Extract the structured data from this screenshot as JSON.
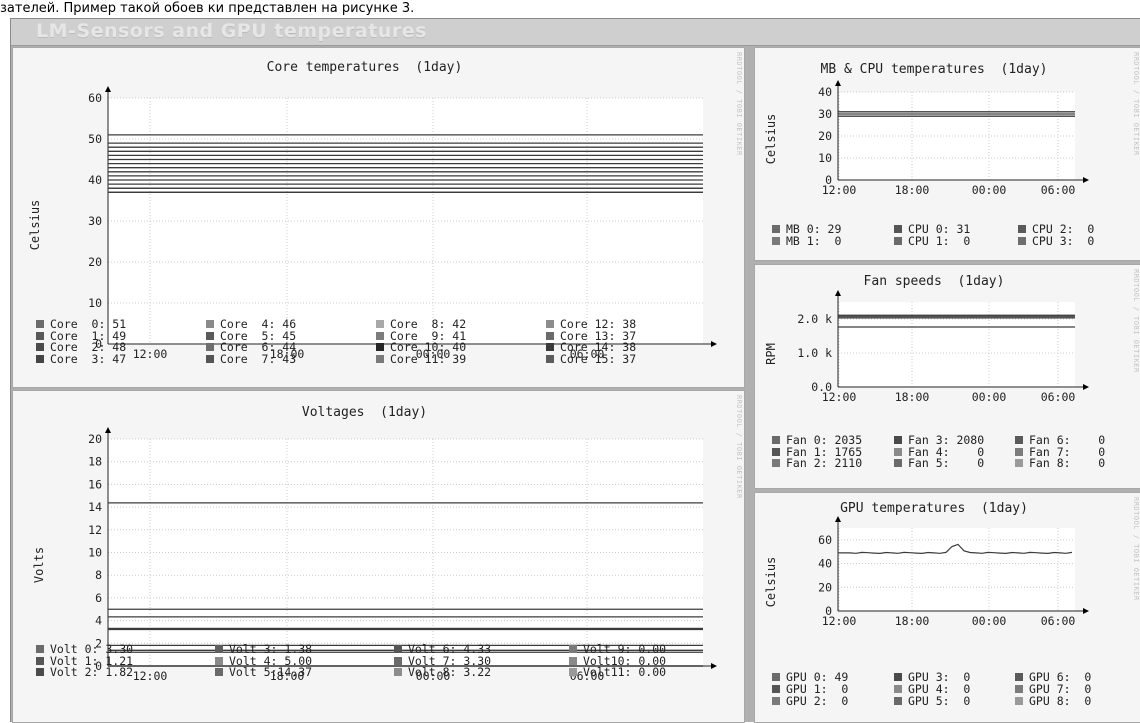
{
  "caption": "зателей. Пример такой обоев ки представлен на рисунке 3.",
  "window": {
    "title": "LM-Sensors and GPU temperatures"
  },
  "watermark": "RRDTOOL / TOBI OETIKER",
  "colors": {
    "frame": "#b0b0b0",
    "panel": "#f5f5f5",
    "plot": "#ffffff",
    "grid": "#d0d0d0",
    "line": "#404040"
  },
  "graphs": [
    {
      "id": "core",
      "title": "Core temperatures  (1day)",
      "ylabel": "Celsius",
      "y_ticks": [
        "0",
        "10",
        "20",
        "30",
        "40",
        "50",
        "60"
      ],
      "y_max": 60,
      "x_ticks": [
        "12:00",
        "18:00",
        "00:00",
        "06:00"
      ],
      "lines": [
        51,
        49,
        48,
        47,
        46,
        45,
        44,
        43,
        42,
        41,
        40,
        39,
        38,
        37,
        38,
        37
      ],
      "legend_cols": [
        [
          "Core  0: 51",
          "Core  1: 49",
          "Core  2: 48",
          "Core  3: 47"
        ],
        [
          "Core  4: 46",
          "Core  5: 45",
          "Core  6: 44",
          "Core  7: 43"
        ],
        [
          "Core  8: 42",
          "Core  9: 41",
          "Core 10: 40",
          "Core 11: 39"
        ],
        [
          "Core 12: 38",
          "Core 13: 37",
          "Core 14: 38",
          "Core 15: 37"
        ]
      ],
      "swatches": [
        [
          "#6b6b6b",
          "#595959",
          "#4c4c4c",
          "#454545"
        ],
        [
          "#8a8a8a",
          "#5a5a5a",
          "#6e6e6e",
          "#555555"
        ],
        [
          "#a8a8a8",
          "#7c7c7c",
          "#262626",
          "#7a7a7a"
        ],
        [
          "#8c8c8c",
          "#6a6a6a",
          "#3a3a3a",
          "#5c5c5c"
        ]
      ]
    },
    {
      "id": "volt",
      "title": "Voltages  (1day)",
      "ylabel": "Volts",
      "y_ticks": [
        "0",
        "2",
        "4",
        "6",
        "8",
        "10",
        "12",
        "14",
        "16",
        "18",
        "20"
      ],
      "y_max": 20,
      "x_ticks": [
        "12:00",
        "18:00",
        "00:00",
        "06:00"
      ],
      "lines": [
        3.3,
        1.21,
        1.82,
        1.38,
        5.0,
        14.37,
        4.33,
        3.3,
        3.22,
        0.0,
        0.0,
        0.0
      ],
      "legend_cols": [
        [
          "Volt 0: 3.30",
          "Volt 1: 1.21",
          "Volt 2: 1.82"
        ],
        [
          "Volt 3: 1.38",
          "Volt 4: 5.00",
          "Volt 5:14.37"
        ],
        [
          "Volt 6: 4.33",
          "Volt 7: 3.30",
          "Volt 8: 3.22"
        ],
        [
          "Volt 9: 0.00",
          "Volt10: 0.00",
          "Volt11: 0.00"
        ]
      ],
      "swatches": [
        [
          "#6b6b6b",
          "#555555",
          "#4a4a4a"
        ],
        [
          "#5e5e5e",
          "#8a8a8a",
          "#6a6a6a"
        ],
        [
          "#555555",
          "#6b6b6b",
          "#8c8c8c"
        ],
        [
          "#7a7a7a",
          "#8a8a8a",
          "#9a9a9a"
        ]
      ]
    },
    {
      "id": "mbcpu",
      "title": "MB & CPU temperatures  (1day)",
      "ylabel": "Celsius",
      "y_ticks": [
        "0",
        "10",
        "20",
        "30",
        "40"
      ],
      "y_max": 40,
      "x_ticks": [
        "12:00",
        "18:00",
        "00:00",
        "06:00"
      ],
      "lines": [
        29,
        31,
        30
      ],
      "legend_cols": [
        [
          "MB 0: 29",
          "MB 1:  0"
        ],
        [
          "CPU 0: 31",
          "CPU 1:  0"
        ],
        [
          "CPU 2:  0",
          "CPU 3:  0"
        ]
      ],
      "swatches": [
        [
          "#6b6b6b",
          "#7a7a7a"
        ],
        [
          "#555555",
          "#6a6a6a"
        ],
        [
          "#5a5a5a",
          "#6e6e6e"
        ]
      ]
    },
    {
      "id": "fan",
      "title": "Fan speeds  (1day)",
      "ylabel": "RPM",
      "y_ticks": [
        "0.0",
        "1.0 k",
        "2.0 k"
      ],
      "y_max": 2500,
      "x_ticks": [
        "12:00",
        "18:00",
        "00:00",
        "06:00"
      ],
      "lines": [
        2035,
        1765,
        2110,
        2080
      ],
      "legend_cols": [
        [
          "Fan 0: 2035",
          "Fan 1: 1765",
          "Fan 2: 2110"
        ],
        [
          "Fan 3: 2080",
          "Fan 4:    0",
          "Fan 5:    0"
        ],
        [
          "Fan 6:    0",
          "Fan 7:    0",
          "Fan 8:    0"
        ]
      ],
      "swatches": [
        [
          "#6b6b6b",
          "#555555",
          "#7a7a7a"
        ],
        [
          "#4a4a4a",
          "#8a8a8a",
          "#6a6a6a"
        ],
        [
          "#5a5a5a",
          "#7c7c7c",
          "#9a9a9a"
        ]
      ]
    },
    {
      "id": "gpu",
      "title": "GPU temperatures  (1day)",
      "ylabel": "Celsius",
      "y_ticks": [
        "0",
        "20",
        "40",
        "60"
      ],
      "y_max": 70,
      "x_ticks": [
        "12:00",
        "18:00",
        "00:00",
        "06:00"
      ],
      "lines": [],
      "legend_cols": [
        [
          "GPU 0: 49",
          "GPU 1:  0",
          "GPU 2:  0"
        ],
        [
          "GPU 3:  0",
          "GPU 4:  0",
          "GPU 5:  0"
        ],
        [
          "GPU 6:  0",
          "GPU 7:  0",
          "GPU 8:  0"
        ]
      ],
      "swatches": [
        [
          "#6b6b6b",
          "#555555",
          "#7a7a7a"
        ],
        [
          "#4a4a4a",
          "#8a8a8a",
          "#6a6a6a"
        ],
        [
          "#5a5a5a",
          "#7c7c7c",
          "#9a9a9a"
        ]
      ]
    }
  ],
  "chart_data": [
    {
      "type": "line",
      "title": "Core temperatures  (1day)",
      "ylabel": "Celsius",
      "ylim": [
        0,
        60
      ],
      "x": [
        "12:00",
        "18:00",
        "00:00",
        "06:00"
      ],
      "series": [
        {
          "name": "Core  0",
          "value": 51
        },
        {
          "name": "Core  1",
          "value": 49
        },
        {
          "name": "Core  2",
          "value": 48
        },
        {
          "name": "Core  3",
          "value": 47
        },
        {
          "name": "Core  4",
          "value": 46
        },
        {
          "name": "Core  5",
          "value": 45
        },
        {
          "name": "Core  6",
          "value": 44
        },
        {
          "name": "Core  7",
          "value": 43
        },
        {
          "name": "Core  8",
          "value": 42
        },
        {
          "name": "Core  9",
          "value": 41
        },
        {
          "name": "Core 10",
          "value": 40
        },
        {
          "name": "Core 11",
          "value": 39
        },
        {
          "name": "Core 12",
          "value": 38
        },
        {
          "name": "Core 13",
          "value": 37
        },
        {
          "name": "Core 14",
          "value": 38
        },
        {
          "name": "Core 15",
          "value": 37
        }
      ]
    },
    {
      "type": "line",
      "title": "Voltages  (1day)",
      "ylabel": "Volts",
      "ylim": [
        0,
        20
      ],
      "x": [
        "12:00",
        "18:00",
        "00:00",
        "06:00"
      ],
      "series": [
        {
          "name": "Volt 0",
          "value": 3.3
        },
        {
          "name": "Volt 1",
          "value": 1.21
        },
        {
          "name": "Volt 2",
          "value": 1.82
        },
        {
          "name": "Volt 3",
          "value": 1.38
        },
        {
          "name": "Volt 4",
          "value": 5.0
        },
        {
          "name": "Volt 5",
          "value": 14.37
        },
        {
          "name": "Volt 6",
          "value": 4.33
        },
        {
          "name": "Volt 7",
          "value": 3.3
        },
        {
          "name": "Volt 8",
          "value": 3.22
        },
        {
          "name": "Volt 9",
          "value": 0.0
        },
        {
          "name": "Volt10",
          "value": 0.0
        },
        {
          "name": "Volt11",
          "value": 0.0
        }
      ]
    },
    {
      "type": "line",
      "title": "MB & CPU temperatures  (1day)",
      "ylabel": "Celsius",
      "ylim": [
        0,
        40
      ],
      "x": [
        "12:00",
        "18:00",
        "00:00",
        "06:00"
      ],
      "series": [
        {
          "name": "MB 0",
          "value": 29
        },
        {
          "name": "MB 1",
          "value": 0
        },
        {
          "name": "CPU 0",
          "value": 31
        },
        {
          "name": "CPU 1",
          "value": 0
        },
        {
          "name": "CPU 2",
          "value": 0
        },
        {
          "name": "CPU 3",
          "value": 0
        }
      ]
    },
    {
      "type": "line",
      "title": "Fan speeds  (1day)",
      "ylabel": "RPM",
      "ylim": [
        0,
        2500
      ],
      "x": [
        "12:00",
        "18:00",
        "00:00",
        "06:00"
      ],
      "series": [
        {
          "name": "Fan 0",
          "value": 2035
        },
        {
          "name": "Fan 1",
          "value": 1765
        },
        {
          "name": "Fan 2",
          "value": 2110
        },
        {
          "name": "Fan 3",
          "value": 2080
        },
        {
          "name": "Fan 4",
          "value": 0
        },
        {
          "name": "Fan 5",
          "value": 0
        },
        {
          "name": "Fan 6",
          "value": 0
        },
        {
          "name": "Fan 7",
          "value": 0
        },
        {
          "name": "Fan 8",
          "value": 0
        }
      ]
    },
    {
      "type": "line",
      "title": "GPU temperatures  (1day)",
      "ylabel": "Celsius",
      "ylim": [
        0,
        70
      ],
      "x": [
        "12:00",
        "18:00",
        "00:00",
        "06:00"
      ],
      "series": [
        {
          "name": "GPU 0",
          "value": 49
        },
        {
          "name": "GPU 1",
          "value": 0
        },
        {
          "name": "GPU 2",
          "value": 0
        },
        {
          "name": "GPU 3",
          "value": 0
        },
        {
          "name": "GPU 4",
          "value": 0
        },
        {
          "name": "GPU 5",
          "value": 0
        },
        {
          "name": "GPU 6",
          "value": 0
        },
        {
          "name": "GPU 7",
          "value": 0
        },
        {
          "name": "GPU 8",
          "value": 0
        }
      ]
    }
  ]
}
